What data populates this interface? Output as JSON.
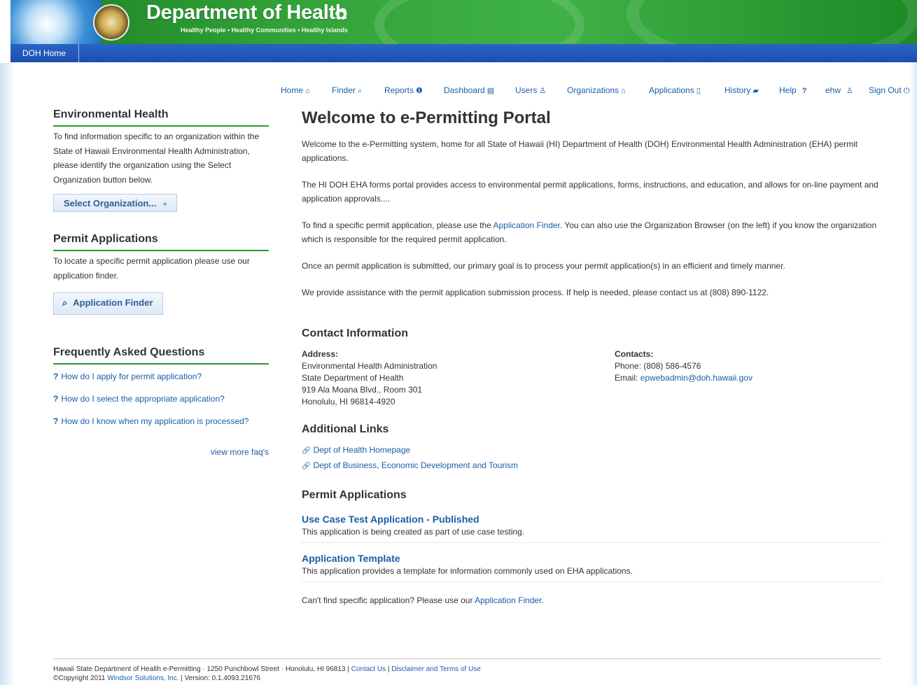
{
  "header": {
    "title": "Department of Health",
    "tagline": "Healthy People • Healthy Communities • Healthy Islands",
    "nav_tab": "DOH Home"
  },
  "topmenu": [
    {
      "label": "Home",
      "icon": "home-icon",
      "glyph": "⌂"
    },
    {
      "label": "Finder",
      "icon": "search-icon",
      "glyph": "⌕"
    },
    {
      "label": "Reports",
      "icon": "info-icon",
      "glyph": "❶"
    },
    {
      "label": "Dashboard",
      "icon": "dashboard-icon",
      "glyph": "▤"
    },
    {
      "label": "Users",
      "icon": "user-icon",
      "glyph": "♙"
    },
    {
      "label": "Organizations",
      "icon": "building-icon",
      "glyph": "⌂"
    },
    {
      "label": "Applications",
      "icon": "document-icon",
      "glyph": "▯"
    },
    {
      "label": "History",
      "icon": "folder-icon",
      "glyph": "▰"
    },
    {
      "label": "Help",
      "icon": "help-icon",
      "glyph": "?"
    },
    {
      "label": "ehw",
      "icon": "user-icon",
      "glyph": "♙"
    },
    {
      "label": "Sign Out",
      "icon": "power-icon",
      "glyph": "⏻"
    }
  ],
  "sidebar": {
    "env_heading": "Environmental Health",
    "env_text": "To find information specific to an organization within the State of Hawaii Environmental Health Administration, please identify the organization using the Select Organization button below.",
    "select_org_label": "Select Organization...",
    "permit_heading": "Permit Applications",
    "permit_text": "To locate a specific permit application please use our application finder.",
    "finder_label": "Application Finder",
    "faq_heading": "Frequently Asked Questions",
    "faqs": [
      "How do I apply for permit application?",
      "How do I select the appropriate application?",
      "How do I know when my application is processed?"
    ],
    "view_more": "view more faq's"
  },
  "main": {
    "title": "Welcome to e-Permitting Portal",
    "p1": "Welcome to the e-Permitting system, home for all State of Hawaii (HI) Department of Health (DOH) Environmental Health Administration (EHA) permit applications.",
    "p2": "The HI DOH EHA forms portal  provides access to environmental permit applications, forms, instructions, and education, and allows for on-line payment and application approvals....",
    "p3_before": "To find a specific permit application, please use the ",
    "p3_link": "Application Finder",
    "p3_after": ". You can also use the Organization Browser (on the left) if you know the organization which is responsible for the required permit application.",
    "p4": "Once an permit application is submitted, our primary goal is to process your permit application(s) in an efficient and timely manner.",
    "p5": "We provide assistance with the permit application submission process. If help is needed, please contact us at (808) 890-1122."
  },
  "contact": {
    "heading": "Contact Information",
    "address_label": "Address:",
    "address_lines": [
      "Environmental Health Administration",
      "State Department of Health",
      "919 Ala Moana Blvd., Room 301",
      "Honolulu, HI 96814-4920"
    ],
    "contacts_label": "Contacts:",
    "phone": "Phone: (808) 586-4576",
    "email_prefix": "Email: ",
    "email": "epwebadmin@doh.hawaii.gov"
  },
  "links": {
    "heading": "Additional Links",
    "items": [
      "Dept of Health Homepage",
      "Dept of Business, Economic Development and Tourism"
    ]
  },
  "applications": {
    "heading": "Permit Applications",
    "items": [
      {
        "title": "Use Case Test Application - Published",
        "desc": "This application is being created as part of use case testing."
      },
      {
        "title": "Application Template",
        "desc": "This application provides a template for information commonly used on EHA applications."
      }
    ],
    "cant_find_before": "Can't find specific application? Please use our ",
    "cant_find_link": "Application Finder",
    "cant_find_after": "."
  },
  "footer": {
    "line1_text": "Hawaii State Department of Health e-Permitting · 1250 Punchbowl Street · Honolulu, HI 96813 | ",
    "contact_us": "Contact Us",
    "sep": " | ",
    "disclaimer": "Disclaimer and Terms of Use",
    "copyright_prefix": "©Copyright 2011 ",
    "windsor": "Windsor Solutions, Inc.",
    "version": " |  Version: 0.1.4093.21676"
  }
}
